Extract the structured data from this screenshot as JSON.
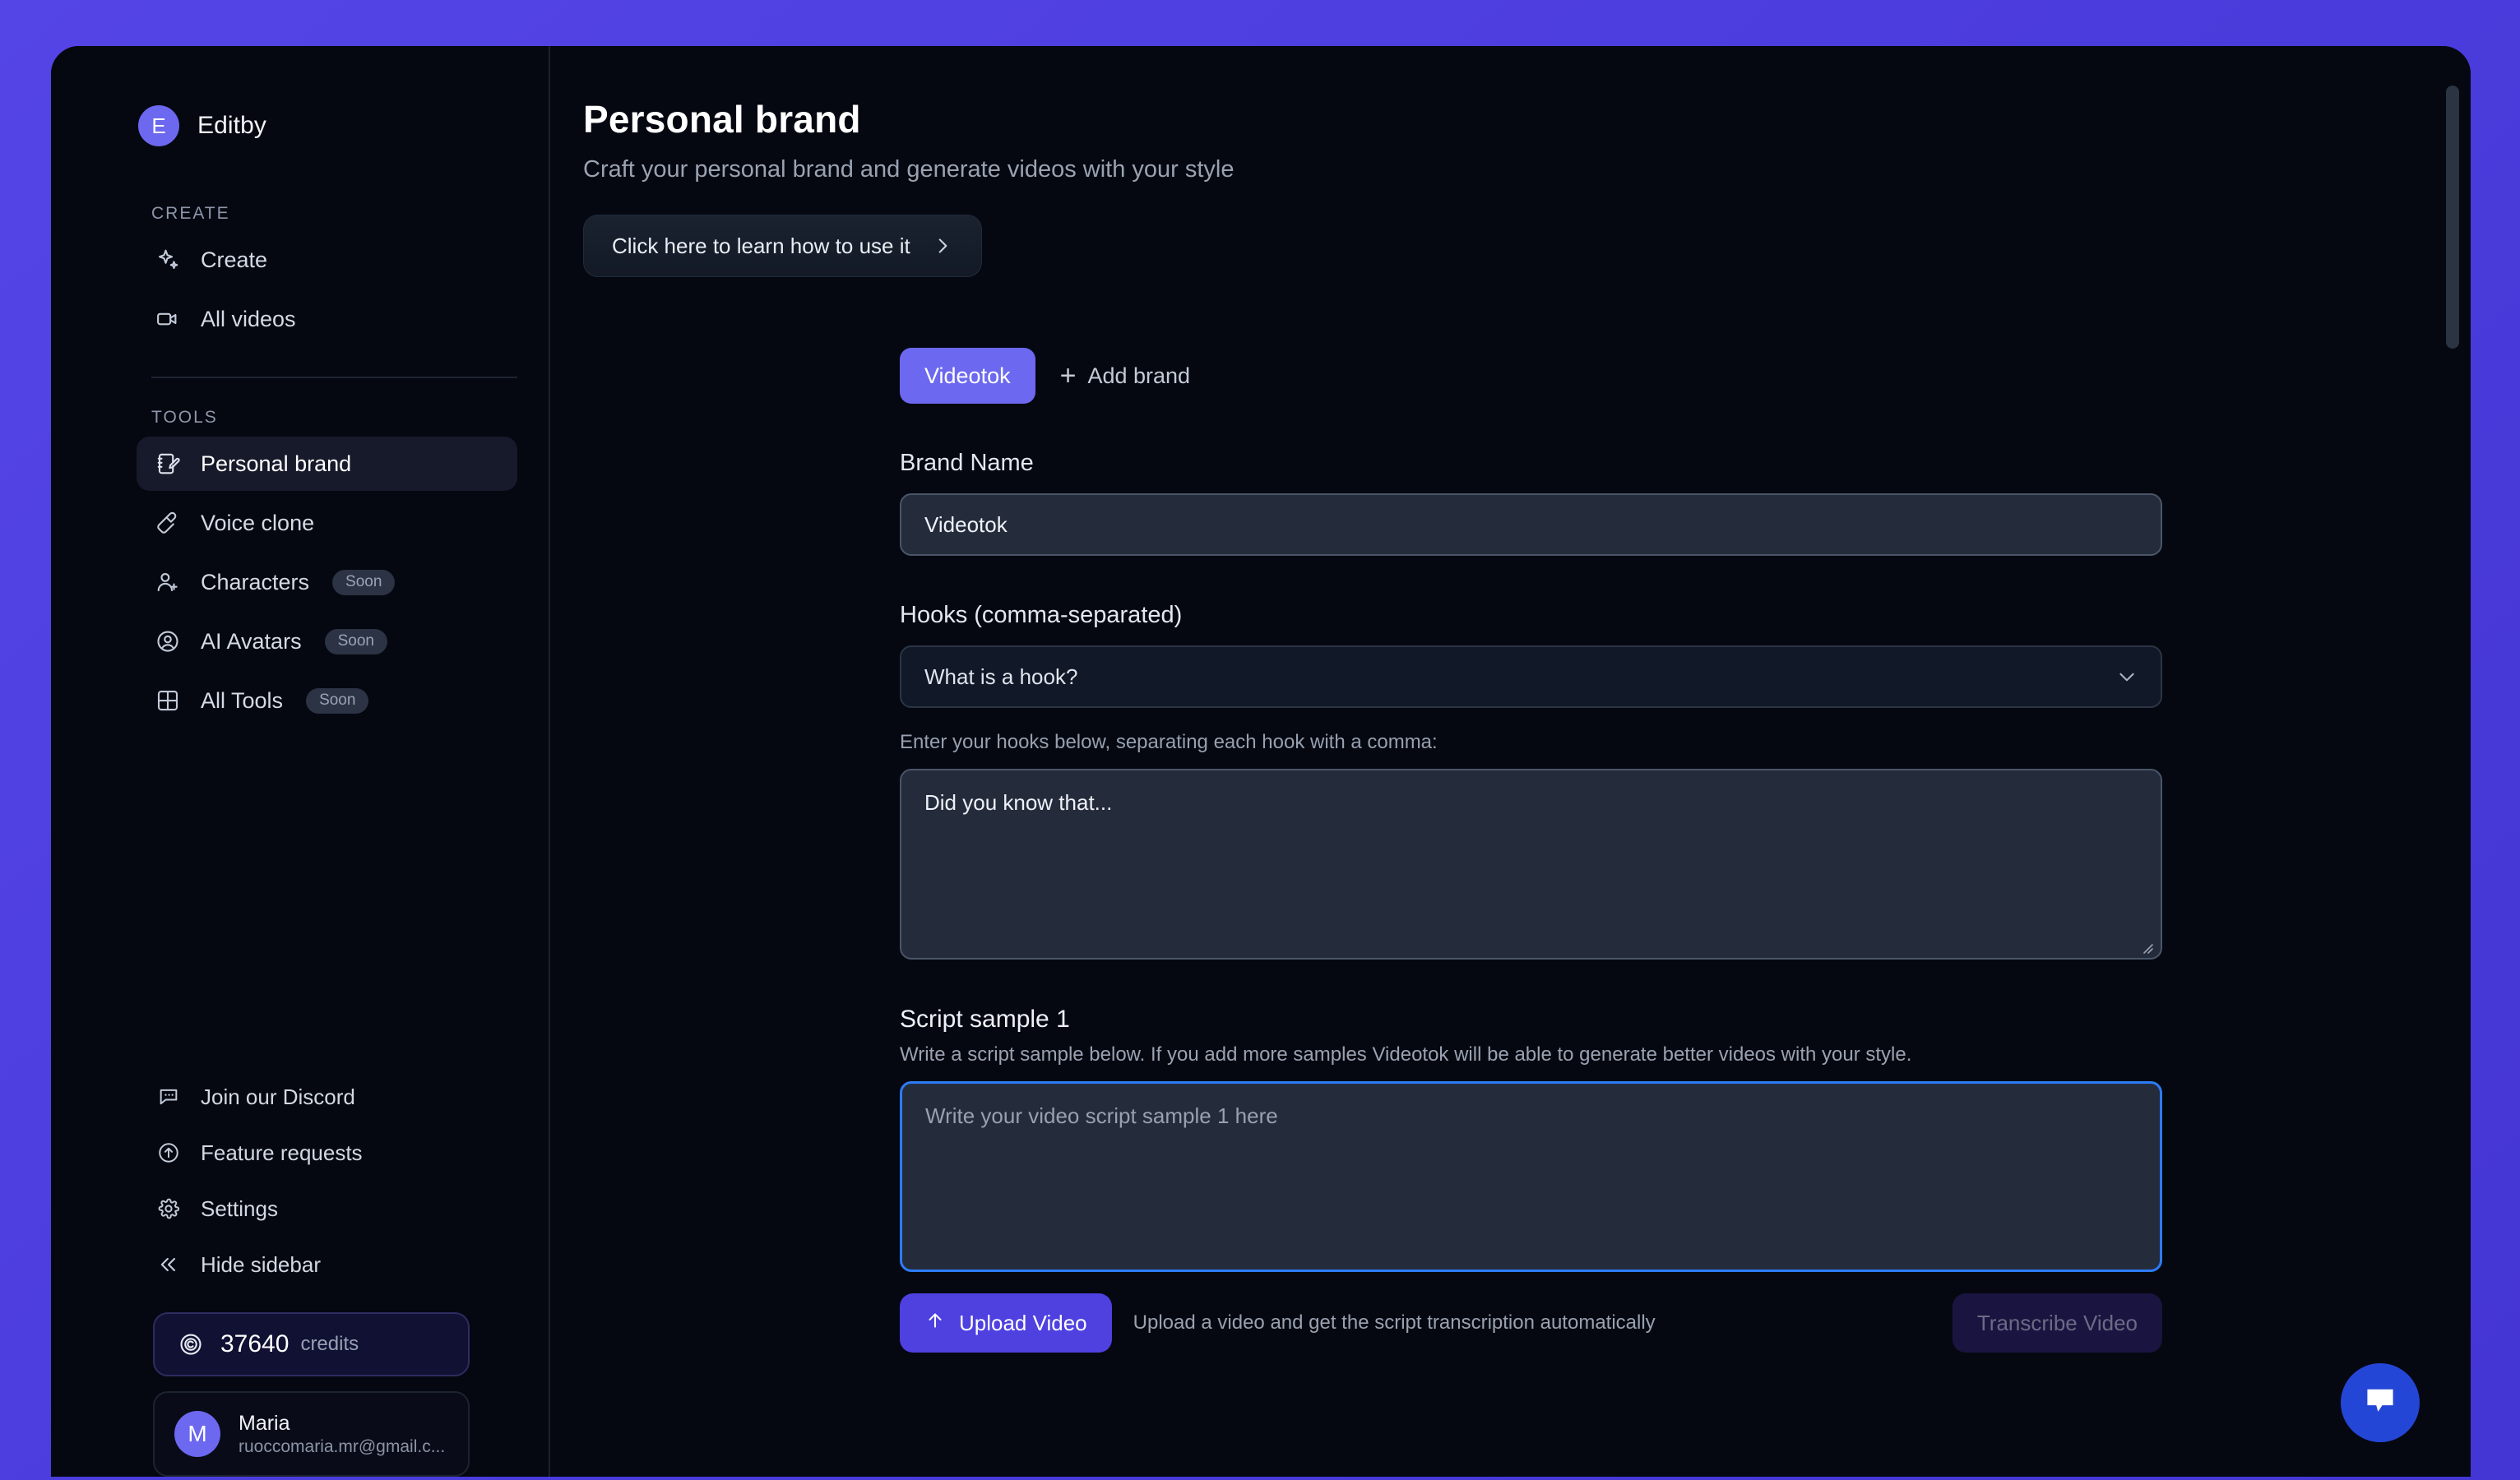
{
  "brand": {
    "initial": "E",
    "name": "Editby"
  },
  "sidebar": {
    "create_label": "CREATE",
    "tools_label": "TOOLS",
    "create_items": [
      {
        "label": "Create",
        "icon": "sparkles-icon"
      },
      {
        "label": "All videos",
        "icon": "video-camera-icon"
      }
    ],
    "tools_items": [
      {
        "label": "Personal brand",
        "icon": "notebook-pen-icon",
        "badge": "",
        "active": true
      },
      {
        "label": "Voice clone",
        "icon": "microphone-icon",
        "badge": "",
        "active": false
      },
      {
        "label": "Characters",
        "icon": "user-plus-icon",
        "badge": "Soon",
        "active": false
      },
      {
        "label": "AI Avatars",
        "icon": "user-circle-icon",
        "badge": "Soon",
        "active": false
      },
      {
        "label": "All Tools",
        "icon": "grid-icon",
        "badge": "Soon",
        "active": false
      }
    ],
    "footer_items": [
      {
        "label": "Join our Discord",
        "icon": "chat-bubble-icon"
      },
      {
        "label": "Feature requests",
        "icon": "arrow-up-circle-icon"
      },
      {
        "label": "Settings",
        "icon": "gear-icon"
      },
      {
        "label": "Hide sidebar",
        "icon": "chevrons-left-icon"
      }
    ],
    "credits": {
      "amount": "37640",
      "word": "credits",
      "icon": "credit-coin-icon"
    },
    "user": {
      "initial": "M",
      "name": "Maria",
      "email": "ruoccomaria.mr@gmail.c..."
    }
  },
  "page": {
    "title": "Personal brand",
    "subtitle": "Craft your personal brand and generate videos with your style",
    "learn_button": "Click here to learn how to use it"
  },
  "form": {
    "tabs": [
      {
        "label": "Videotok",
        "selected": true
      }
    ],
    "add_brand_label": "Add brand",
    "brand_name_label": "Brand Name",
    "brand_name_value": "Videotok",
    "hooks_label": "Hooks (comma-separated)",
    "hooks_accordion_label": "What is a hook?",
    "hooks_help": "Enter your hooks below, separating each hook with a comma:",
    "hooks_value": "Did you know that...",
    "script_title": "Script sample 1",
    "script_desc": "Write a script sample below. If you add more samples Videotok will be able to generate better videos with your style.",
    "script_placeholder": "Write your video script sample 1 here",
    "upload_button": "Upload Video",
    "upload_note": "Upload a video and get the script transcription automatically",
    "transcribe_button": "Transcribe Video"
  },
  "widgets": {
    "chat_icon": "chat-bubble-icon"
  },
  "colors": {
    "page_background": "#4f40e0",
    "app_background": "#050810",
    "accent_purple": "#6c68ef",
    "upload_purple": "#4f40e0",
    "focus_blue": "#2d7bf6",
    "chat_blue": "#2446d6"
  }
}
